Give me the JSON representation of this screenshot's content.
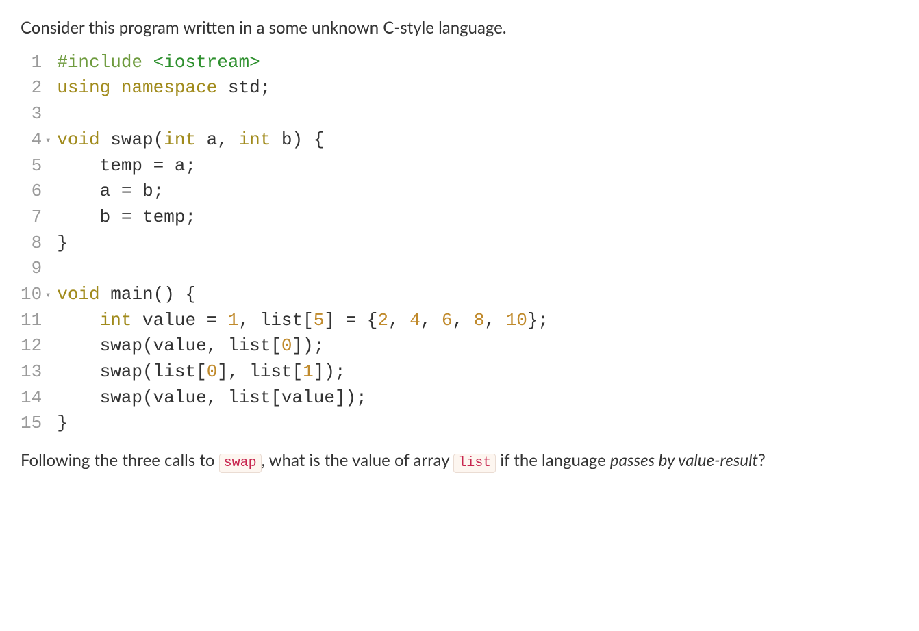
{
  "intro": "Consider this program written in a some unknown C-style language.",
  "code": {
    "lines": [
      {
        "n": "1",
        "fold": "",
        "tokens": [
          [
            "pp",
            "#include "
          ],
          [
            "str",
            "<iostream>"
          ]
        ]
      },
      {
        "n": "2",
        "fold": "",
        "tokens": [
          [
            "kw",
            "using "
          ],
          [
            "kw",
            "namespace"
          ],
          [
            "id",
            " std"
          ],
          [
            "pun",
            ";"
          ]
        ]
      },
      {
        "n": "3",
        "fold": "",
        "tokens": []
      },
      {
        "n": "4",
        "fold": "▾",
        "tokens": [
          [
            "kw",
            "void "
          ],
          [
            "fn",
            "swap"
          ],
          [
            "pun",
            "("
          ],
          [
            "kw",
            "int"
          ],
          [
            "id",
            " a"
          ],
          [
            "pun",
            ", "
          ],
          [
            "kw",
            "int"
          ],
          [
            "id",
            " b"
          ],
          [
            "pun",
            ") {"
          ]
        ]
      },
      {
        "n": "5",
        "fold": "",
        "tokens": [
          [
            "id",
            "    temp "
          ],
          [
            "pun",
            "= "
          ],
          [
            "id",
            "a"
          ],
          [
            "pun",
            ";"
          ]
        ]
      },
      {
        "n": "6",
        "fold": "",
        "tokens": [
          [
            "id",
            "    a "
          ],
          [
            "pun",
            "= "
          ],
          [
            "id",
            "b"
          ],
          [
            "pun",
            ";"
          ]
        ]
      },
      {
        "n": "7",
        "fold": "",
        "tokens": [
          [
            "id",
            "    b "
          ],
          [
            "pun",
            "= "
          ],
          [
            "id",
            "temp"
          ],
          [
            "pun",
            ";"
          ]
        ]
      },
      {
        "n": "8",
        "fold": "",
        "tokens": [
          [
            "pun",
            "}"
          ]
        ]
      },
      {
        "n": "9",
        "fold": "",
        "tokens": []
      },
      {
        "n": "10",
        "fold": "▾",
        "tokens": [
          [
            "kw",
            "void "
          ],
          [
            "fn",
            "main"
          ],
          [
            "pun",
            "() {"
          ]
        ]
      },
      {
        "n": "11",
        "fold": "",
        "tokens": [
          [
            "id",
            "    "
          ],
          [
            "kw",
            "int"
          ],
          [
            "id",
            " value "
          ],
          [
            "pun",
            "= "
          ],
          [
            "num",
            "1"
          ],
          [
            "pun",
            ", "
          ],
          [
            "id",
            "list"
          ],
          [
            "pun",
            "["
          ],
          [
            "num",
            "5"
          ],
          [
            "pun",
            "] = {"
          ],
          [
            "num",
            "2"
          ],
          [
            "pun",
            ", "
          ],
          [
            "num",
            "4"
          ],
          [
            "pun",
            ", "
          ],
          [
            "num",
            "6"
          ],
          [
            "pun",
            ", "
          ],
          [
            "num",
            "8"
          ],
          [
            "pun",
            ", "
          ],
          [
            "num",
            "10"
          ],
          [
            "pun",
            "};"
          ]
        ]
      },
      {
        "n": "12",
        "fold": "",
        "tokens": [
          [
            "id",
            "    swap"
          ],
          [
            "pun",
            "("
          ],
          [
            "id",
            "value"
          ],
          [
            "pun",
            ", "
          ],
          [
            "id",
            "list"
          ],
          [
            "pun",
            "["
          ],
          [
            "num",
            "0"
          ],
          [
            "pun",
            "]);"
          ]
        ]
      },
      {
        "n": "13",
        "fold": "",
        "tokens": [
          [
            "id",
            "    swap"
          ],
          [
            "pun",
            "("
          ],
          [
            "id",
            "list"
          ],
          [
            "pun",
            "["
          ],
          [
            "num",
            "0"
          ],
          [
            "pun",
            "], "
          ],
          [
            "id",
            "list"
          ],
          [
            "pun",
            "["
          ],
          [
            "num",
            "1"
          ],
          [
            "pun",
            "]);"
          ]
        ]
      },
      {
        "n": "14",
        "fold": "",
        "tokens": [
          [
            "id",
            "    swap"
          ],
          [
            "pun",
            "("
          ],
          [
            "id",
            "value"
          ],
          [
            "pun",
            ", "
          ],
          [
            "id",
            "list"
          ],
          [
            "pun",
            "["
          ],
          [
            "id",
            "value"
          ],
          [
            "pun",
            "]);"
          ]
        ]
      },
      {
        "n": "15",
        "fold": "",
        "tokens": [
          [
            "pun",
            "}"
          ]
        ]
      }
    ]
  },
  "question": {
    "p1": "Following the three calls to ",
    "code1": "swap",
    "p2": ", what is the value of array ",
    "code2": "list",
    "p3": " if the language ",
    "italic": "passes by value-result",
    "p4": "?"
  }
}
